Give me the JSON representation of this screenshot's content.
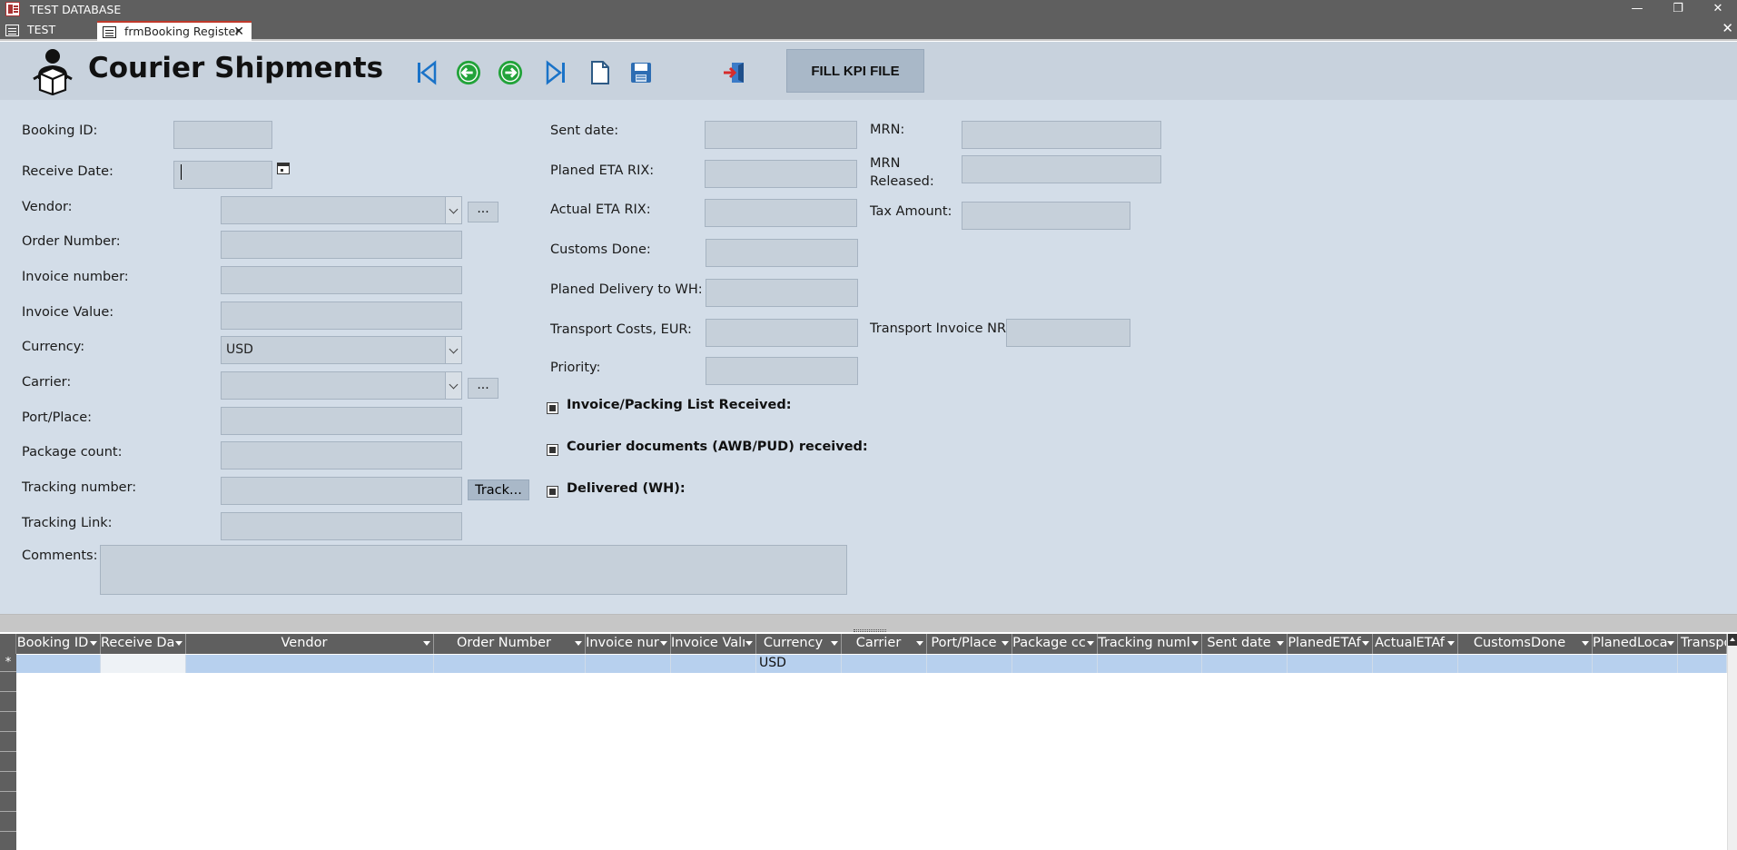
{
  "window": {
    "title": "TEST DATABASE"
  },
  "tabs": [
    {
      "label": "TEST ACCDB"
    },
    {
      "label": "frmBooking Register"
    }
  ],
  "header": {
    "title": "Courier Shipments",
    "fill_kpi_label": "FILL KPI FILE"
  },
  "labels": {
    "booking_id": "Booking ID:",
    "receive_date": "Receive Date:",
    "vendor": "Vendor:",
    "order_number": "Order Number:",
    "invoice_number": "Invoice number:",
    "invoice_value": "Invoice Value:",
    "currency": "Currency:",
    "carrier": "Carrier:",
    "port_place": "Port/Place:",
    "package_count": "Package count:",
    "tracking_number": "Tracking number:",
    "tracking_link": "Tracking Link:",
    "comments": "Comments:",
    "sent_date": "Sent date:",
    "planed_eta_rix": "Planed ETA RIX:",
    "actual_eta_rix": "Actual ETA RIX:",
    "customs_done": "Customs Done:",
    "planed_delivery": "Planed Delivery to WH:",
    "transport_costs": "Transport Costs, EUR:",
    "priority": "Priority:",
    "mrn": "MRN:",
    "mrn_released_1": "MRN",
    "mrn_released_2": "Released:",
    "tax_amount": "Tax Amount:",
    "transport_invoice_nr": "Transport Invoice NR:"
  },
  "fields": {
    "currency_value": "USD"
  },
  "buttons": {
    "dots": "...",
    "track": "Track..."
  },
  "checkboxes": {
    "invoice_packing": "Invoice/Packing List Received:",
    "courier_docs": "Courier documents (AWB/PUD) received:",
    "delivered": "Delivered (WH):"
  },
  "datasheet": {
    "columns": [
      "Booking ID",
      "Receive Da",
      "Vendor",
      "Order Number",
      "Invoice nur",
      "Invoice Valı",
      "Currency",
      "Carrier",
      "Port/Place",
      "Package cc",
      "Tracking numl",
      "Sent date",
      "PlanedETAf",
      "ActualETAf",
      "CustomsDone",
      "PlanedLoca",
      "Transpo"
    ],
    "new_row_marker": "*",
    "new_row_currency": "USD"
  },
  "icons": {
    "first_record": "first-record-icon",
    "previous_record": "previous-record-icon",
    "next_record": "next-record-icon",
    "last_record": "last-record-icon",
    "new_record": "new-record-icon",
    "save_record": "save-icon",
    "close_form": "exit-icon"
  },
  "colors": {
    "header_bg": "#c8d2dd",
    "detail_bg": "#d3dde8",
    "field_bg": "#c6d0da",
    "button_bg": "#a9b8c8",
    "title_bar": "#5f5f5f",
    "nav_arrow_green": "#22a33a",
    "nav_blue": "#1a73c8",
    "new_row_highlight": "#b7d0ee"
  }
}
